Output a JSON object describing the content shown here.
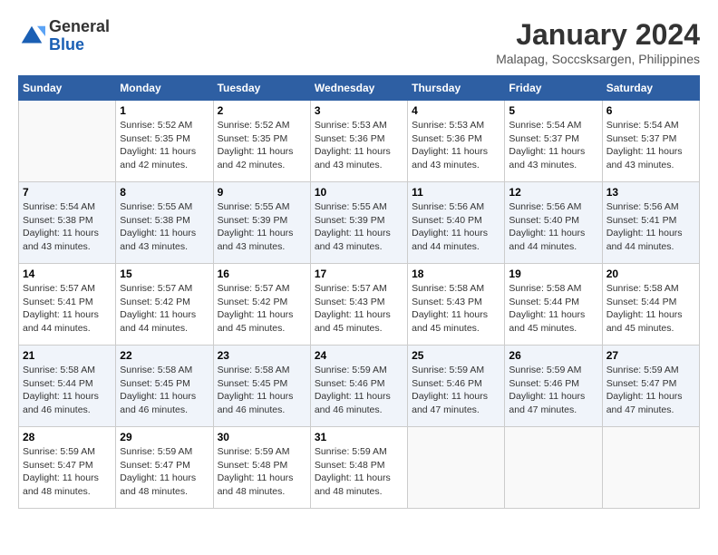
{
  "header": {
    "logo": {
      "general": "General",
      "blue": "Blue"
    },
    "title": "January 2024",
    "location": "Malapag, Soccsksargen, Philippines"
  },
  "days_of_week": [
    "Sunday",
    "Monday",
    "Tuesday",
    "Wednesday",
    "Thursday",
    "Friday",
    "Saturday"
  ],
  "weeks": [
    [
      {
        "day": "",
        "info": ""
      },
      {
        "day": "1",
        "info": "Sunrise: 5:52 AM\nSunset: 5:35 PM\nDaylight: 11 hours\nand 42 minutes."
      },
      {
        "day": "2",
        "info": "Sunrise: 5:52 AM\nSunset: 5:35 PM\nDaylight: 11 hours\nand 42 minutes."
      },
      {
        "day": "3",
        "info": "Sunrise: 5:53 AM\nSunset: 5:36 PM\nDaylight: 11 hours\nand 43 minutes."
      },
      {
        "day": "4",
        "info": "Sunrise: 5:53 AM\nSunset: 5:36 PM\nDaylight: 11 hours\nand 43 minutes."
      },
      {
        "day": "5",
        "info": "Sunrise: 5:54 AM\nSunset: 5:37 PM\nDaylight: 11 hours\nand 43 minutes."
      },
      {
        "day": "6",
        "info": "Sunrise: 5:54 AM\nSunset: 5:37 PM\nDaylight: 11 hours\nand 43 minutes."
      }
    ],
    [
      {
        "day": "7",
        "info": "Sunrise: 5:54 AM\nSunset: 5:38 PM\nDaylight: 11 hours\nand 43 minutes."
      },
      {
        "day": "8",
        "info": "Sunrise: 5:55 AM\nSunset: 5:38 PM\nDaylight: 11 hours\nand 43 minutes."
      },
      {
        "day": "9",
        "info": "Sunrise: 5:55 AM\nSunset: 5:39 PM\nDaylight: 11 hours\nand 43 minutes."
      },
      {
        "day": "10",
        "info": "Sunrise: 5:55 AM\nSunset: 5:39 PM\nDaylight: 11 hours\nand 43 minutes."
      },
      {
        "day": "11",
        "info": "Sunrise: 5:56 AM\nSunset: 5:40 PM\nDaylight: 11 hours\nand 44 minutes."
      },
      {
        "day": "12",
        "info": "Sunrise: 5:56 AM\nSunset: 5:40 PM\nDaylight: 11 hours\nand 44 minutes."
      },
      {
        "day": "13",
        "info": "Sunrise: 5:56 AM\nSunset: 5:41 PM\nDaylight: 11 hours\nand 44 minutes."
      }
    ],
    [
      {
        "day": "14",
        "info": "Sunrise: 5:57 AM\nSunset: 5:41 PM\nDaylight: 11 hours\nand 44 minutes."
      },
      {
        "day": "15",
        "info": "Sunrise: 5:57 AM\nSunset: 5:42 PM\nDaylight: 11 hours\nand 44 minutes."
      },
      {
        "day": "16",
        "info": "Sunrise: 5:57 AM\nSunset: 5:42 PM\nDaylight: 11 hours\nand 45 minutes."
      },
      {
        "day": "17",
        "info": "Sunrise: 5:57 AM\nSunset: 5:43 PM\nDaylight: 11 hours\nand 45 minutes."
      },
      {
        "day": "18",
        "info": "Sunrise: 5:58 AM\nSunset: 5:43 PM\nDaylight: 11 hours\nand 45 minutes."
      },
      {
        "day": "19",
        "info": "Sunrise: 5:58 AM\nSunset: 5:44 PM\nDaylight: 11 hours\nand 45 minutes."
      },
      {
        "day": "20",
        "info": "Sunrise: 5:58 AM\nSunset: 5:44 PM\nDaylight: 11 hours\nand 45 minutes."
      }
    ],
    [
      {
        "day": "21",
        "info": "Sunrise: 5:58 AM\nSunset: 5:44 PM\nDaylight: 11 hours\nand 46 minutes."
      },
      {
        "day": "22",
        "info": "Sunrise: 5:58 AM\nSunset: 5:45 PM\nDaylight: 11 hours\nand 46 minutes."
      },
      {
        "day": "23",
        "info": "Sunrise: 5:58 AM\nSunset: 5:45 PM\nDaylight: 11 hours\nand 46 minutes."
      },
      {
        "day": "24",
        "info": "Sunrise: 5:59 AM\nSunset: 5:46 PM\nDaylight: 11 hours\nand 46 minutes."
      },
      {
        "day": "25",
        "info": "Sunrise: 5:59 AM\nSunset: 5:46 PM\nDaylight: 11 hours\nand 47 minutes."
      },
      {
        "day": "26",
        "info": "Sunrise: 5:59 AM\nSunset: 5:46 PM\nDaylight: 11 hours\nand 47 minutes."
      },
      {
        "day": "27",
        "info": "Sunrise: 5:59 AM\nSunset: 5:47 PM\nDaylight: 11 hours\nand 47 minutes."
      }
    ],
    [
      {
        "day": "28",
        "info": "Sunrise: 5:59 AM\nSunset: 5:47 PM\nDaylight: 11 hours\nand 48 minutes."
      },
      {
        "day": "29",
        "info": "Sunrise: 5:59 AM\nSunset: 5:47 PM\nDaylight: 11 hours\nand 48 minutes."
      },
      {
        "day": "30",
        "info": "Sunrise: 5:59 AM\nSunset: 5:48 PM\nDaylight: 11 hours\nand 48 minutes."
      },
      {
        "day": "31",
        "info": "Sunrise: 5:59 AM\nSunset: 5:48 PM\nDaylight: 11 hours\nand 48 minutes."
      },
      {
        "day": "",
        "info": ""
      },
      {
        "day": "",
        "info": ""
      },
      {
        "day": "",
        "info": ""
      }
    ]
  ]
}
